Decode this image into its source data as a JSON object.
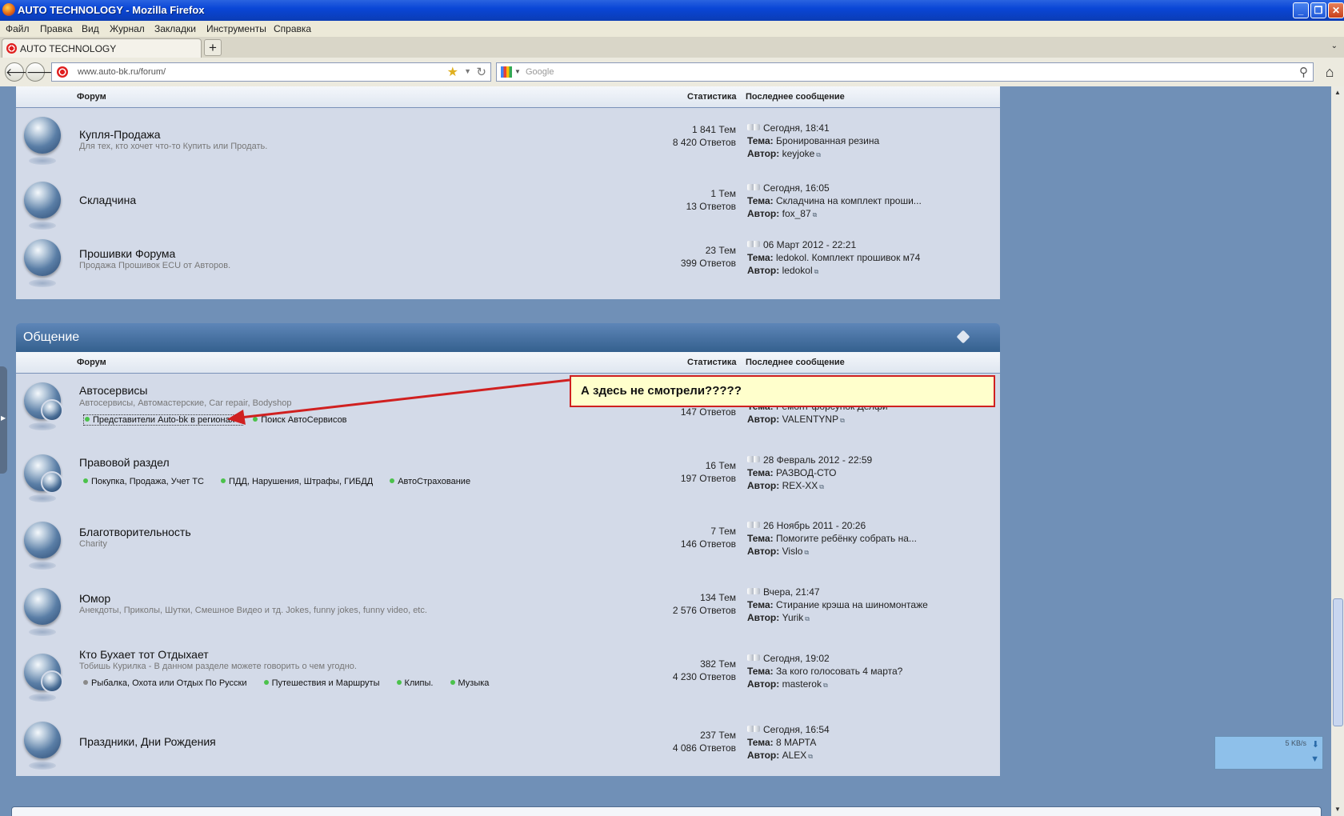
{
  "window": {
    "title": "AUTO TECHNOLOGY - Mozilla Firefox"
  },
  "menu": [
    "Файл",
    "Правка",
    "Вид",
    "Журнал",
    "Закладки",
    "Инструменты",
    "Справка"
  ],
  "tab": {
    "label": "AUTO TECHNOLOGY"
  },
  "address": {
    "url": "www.auto-bk.ru/forum/"
  },
  "search": {
    "placeholder": "Google"
  },
  "columns": {
    "forum": "Форум",
    "stats": "Статистика",
    "last": "Последнее сообщение"
  },
  "labels": {
    "topic": "Тема:",
    "author": "Автор:"
  },
  "section1": {
    "rows": [
      {
        "title": "Купля-Продажа",
        "desc": "Для тех, кто хочет что-то Купить или Продать.",
        "topics": "1  841 Тем",
        "replies": "8  420 Ответов",
        "date": "Сегодня, 18:41",
        "topic": "Бронированная резина",
        "author": "keyjoke"
      },
      {
        "title": "Складчина",
        "desc": "",
        "topics": "1 Тем",
        "replies": "13 Ответов",
        "date": "Сегодня, 16:05",
        "topic": "Складчина на комплект проши...",
        "author": "fox_87"
      },
      {
        "title": "Прошивки Форума",
        "desc": "Продажа Прошивок ECU от Авторов.",
        "topics": "23 Тем",
        "replies": "399 Ответов",
        "date": "06 Март 2012 - 22:21",
        "topic": "ledokol. Комплект прошивок м74",
        "author": "ledokol"
      }
    ]
  },
  "section2": {
    "title": "Общение",
    "rows": [
      {
        "title": "Автосервисы",
        "desc": "Автосервисы, Автомастерские, Car repair, Bodyshop",
        "subforums": [
          "Представители Auto-bk в регионах",
          "Поиск АвтоСервисов"
        ],
        "topics": "",
        "replies": "147 Ответов",
        "date": "",
        "topic": "Ремонт форсунок Делфи",
        "author": "VALENTYNP"
      },
      {
        "title": "Правовой раздел",
        "desc": "",
        "subforums": [
          "Покупка, Продажа, Учет ТС",
          "ПДД, Нарушения, Штрафы, ГИБДД",
          "АвтоСтрахование"
        ],
        "topics": "16 Тем",
        "replies": "197 Ответов",
        "date": "28 Февраль 2012 - 22:59",
        "topic": "РАЗВОД-СТО",
        "author": "REX-XX"
      },
      {
        "title": "Благотворительность",
        "desc": "Charity",
        "subforums": [],
        "topics": "7 Тем",
        "replies": "146 Ответов",
        "date": "26 Ноябрь 2011 - 20:26",
        "topic": "Помогите ребёнку собрать на...",
        "author": "Vislo"
      },
      {
        "title": "Юмор",
        "desc": "Анекдоты, Приколы, Шутки, Смешное Видео и тд. Jokes, funny jokes, funny video, etc.",
        "subforums": [],
        "topics": "134 Тем",
        "replies": "2  576 Ответов",
        "date": "Вчера, 21:47",
        "topic": "Стирание крэша на шиномонтаже",
        "author": "Yurik"
      },
      {
        "title": "Кто Бухает тот Отдыхает",
        "desc": "Тобишь Курилка - В данном разделе можете говорить о чем угодно.",
        "subforums": [
          "Рыбалка, Охота или Отдых По Русски",
          "Путешествия и Маршруты",
          "Клипы.",
          "Музыка"
        ],
        "topics": "382 Тем",
        "replies": "4  230 Ответов",
        "date": "Сегодня, 19:02",
        "topic": "За кого голосовать 4 марта?",
        "author": "masterok"
      },
      {
        "title": "Праздники, Дни Рождения",
        "desc": "",
        "subforums": [],
        "topics": "237 Тем",
        "replies": "4  086 Ответов",
        "date": "Сегодня, 16:54",
        "topic": "8 МАРТА",
        "author": "ALEX"
      }
    ]
  },
  "callout": {
    "text": "А здесь не смотрели?????"
  },
  "download": {
    "rate": "5 KB/s"
  }
}
